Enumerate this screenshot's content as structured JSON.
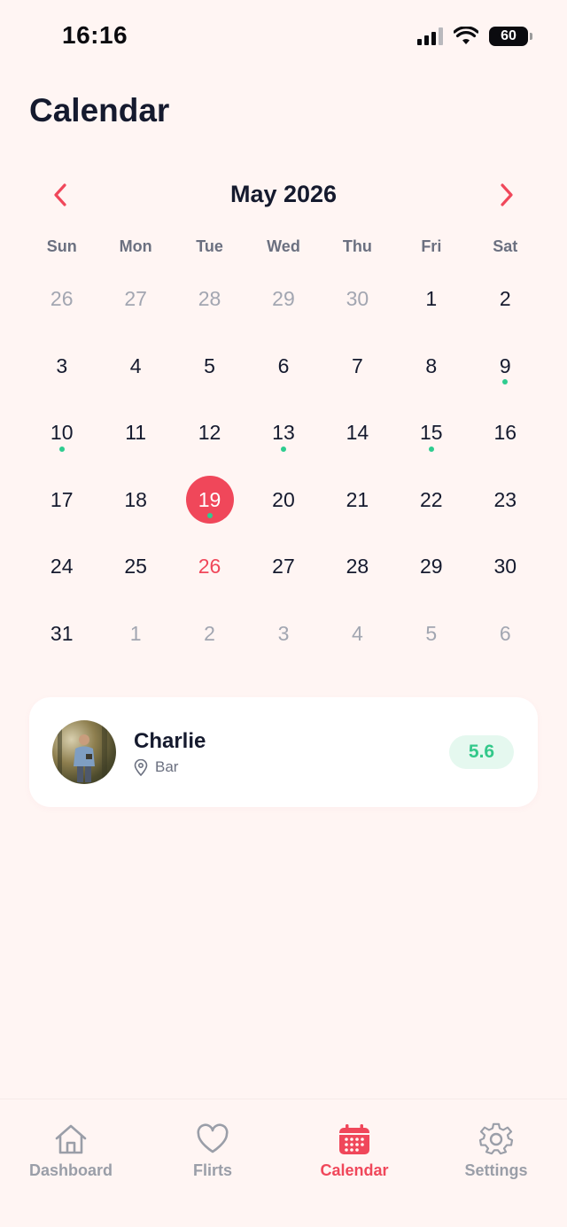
{
  "status_bar": {
    "time": "16:16",
    "battery": "60"
  },
  "header": {
    "title": "Calendar"
  },
  "calendar": {
    "month_label": "May 2026",
    "prev_icon": "chevron-left-icon",
    "next_icon": "chevron-right-icon",
    "accent_color": "#f0475a",
    "event_dot_color": "#2ecc8f",
    "weekdays": [
      "Sun",
      "Mon",
      "Tue",
      "Wed",
      "Thu",
      "Fri",
      "Sat"
    ],
    "weeks": [
      [
        {
          "day": "26",
          "muted": true
        },
        {
          "day": "27",
          "muted": true
        },
        {
          "day": "28",
          "muted": true
        },
        {
          "day": "29",
          "muted": true
        },
        {
          "day": "30",
          "muted": true
        },
        {
          "day": "1"
        },
        {
          "day": "2"
        }
      ],
      [
        {
          "day": "3"
        },
        {
          "day": "4"
        },
        {
          "day": "5"
        },
        {
          "day": "6"
        },
        {
          "day": "7"
        },
        {
          "day": "8"
        },
        {
          "day": "9",
          "dot": true
        }
      ],
      [
        {
          "day": "10",
          "dot": true
        },
        {
          "day": "11"
        },
        {
          "day": "12"
        },
        {
          "day": "13",
          "dot": true
        },
        {
          "day": "14"
        },
        {
          "day": "15",
          "dot": true
        },
        {
          "day": "16"
        }
      ],
      [
        {
          "day": "17"
        },
        {
          "day": "18"
        },
        {
          "day": "19",
          "selected": true,
          "dot": true
        },
        {
          "day": "20"
        },
        {
          "day": "21"
        },
        {
          "day": "22"
        },
        {
          "day": "23"
        }
      ],
      [
        {
          "day": "24"
        },
        {
          "day": "25"
        },
        {
          "day": "26",
          "today": true
        },
        {
          "day": "27"
        },
        {
          "day": "28"
        },
        {
          "day": "29"
        },
        {
          "day": "30"
        }
      ],
      [
        {
          "day": "31"
        },
        {
          "day": "1",
          "muted": true
        },
        {
          "day": "2",
          "muted": true
        },
        {
          "day": "3",
          "muted": true
        },
        {
          "day": "4",
          "muted": true
        },
        {
          "day": "5",
          "muted": true
        },
        {
          "day": "6",
          "muted": true
        }
      ]
    ]
  },
  "event": {
    "name": "Charlie",
    "location": "Bar",
    "location_icon": "map-pin-icon",
    "score": "5.6",
    "score_color": "#33c88a"
  },
  "tabs": [
    {
      "label": "Dashboard",
      "icon": "home-icon",
      "active": false
    },
    {
      "label": "Flirts",
      "icon": "heart-icon",
      "active": false
    },
    {
      "label": "Calendar",
      "icon": "calendar-icon",
      "active": true
    },
    {
      "label": "Settings",
      "icon": "gear-icon",
      "active": false
    }
  ]
}
